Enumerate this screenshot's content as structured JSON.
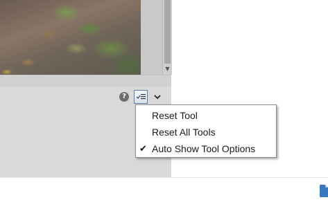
{
  "toolbar": {
    "help_glyph": "?",
    "icons": [
      "help-icon",
      "tool-options-icon",
      "chevron-down-icon"
    ]
  },
  "scrollbar": {
    "down_arrow_glyph": "▼"
  },
  "context_menu": {
    "items": [
      {
        "label": "Reset Tool",
        "checked": false
      },
      {
        "label": "Reset All Tools",
        "checked": false
      },
      {
        "label": "Auto Show Tool Options",
        "checked": true,
        "check_glyph": "✔"
      }
    ]
  },
  "colors": {
    "menu_border": "#8f8f8f",
    "button_border": "#5a7aa3",
    "panel_gray": "#d9d9d9"
  }
}
